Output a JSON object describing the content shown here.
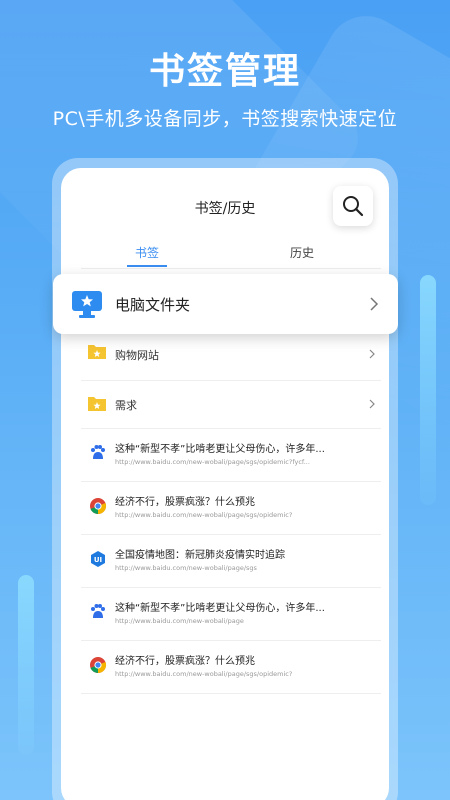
{
  "headline": "书签管理",
  "subline": "PC\\手机多设备同步，书签搜索快速定位",
  "phone": {
    "title": "书签/历史",
    "tabs": [
      {
        "label": "书签",
        "active": true
      },
      {
        "label": "历史",
        "active": false
      }
    ]
  },
  "floating_folder": {
    "label": "电脑文件夹",
    "icon": "pc-star-icon"
  },
  "folders": [
    {
      "label": "购物网站",
      "icon": "folder-star-icon"
    },
    {
      "label": "需求",
      "icon": "folder-star-icon"
    }
  ],
  "links": [
    {
      "icon": "baidu-icon",
      "title": "这种“新型不孝”比啃老更让父母伤心，许多年...",
      "url": "http://www.baidu.com/new-wobali/page/sgs/opidemic?fycf..."
    },
    {
      "icon": "chrome-icon",
      "title": "经济不行，股票疯涨？什么预兆",
      "url": "http://www.baidu.com/new-wobali/page/sgs/opidemic?"
    },
    {
      "icon": "ui-icon",
      "title": "全国疫情地图：新冠肺炎疫情实时追踪",
      "url": "http://www.baidu.com/new-wobali/page/sgs"
    },
    {
      "icon": "baidu-icon",
      "title": "这种“新型不孝”比啃老更让父母伤心，许多年...",
      "url": "http://www.baidu.com/new-wobali/page"
    },
    {
      "icon": "chrome-icon",
      "title": "经济不行，股票疯涨？什么预兆",
      "url": "http://www.baidu.com/new-wobali/page/sgs/opidemic?"
    }
  ],
  "colors": {
    "accent": "#3a8ef0",
    "folder": "#f5c431",
    "background": "#4aa0f4"
  }
}
